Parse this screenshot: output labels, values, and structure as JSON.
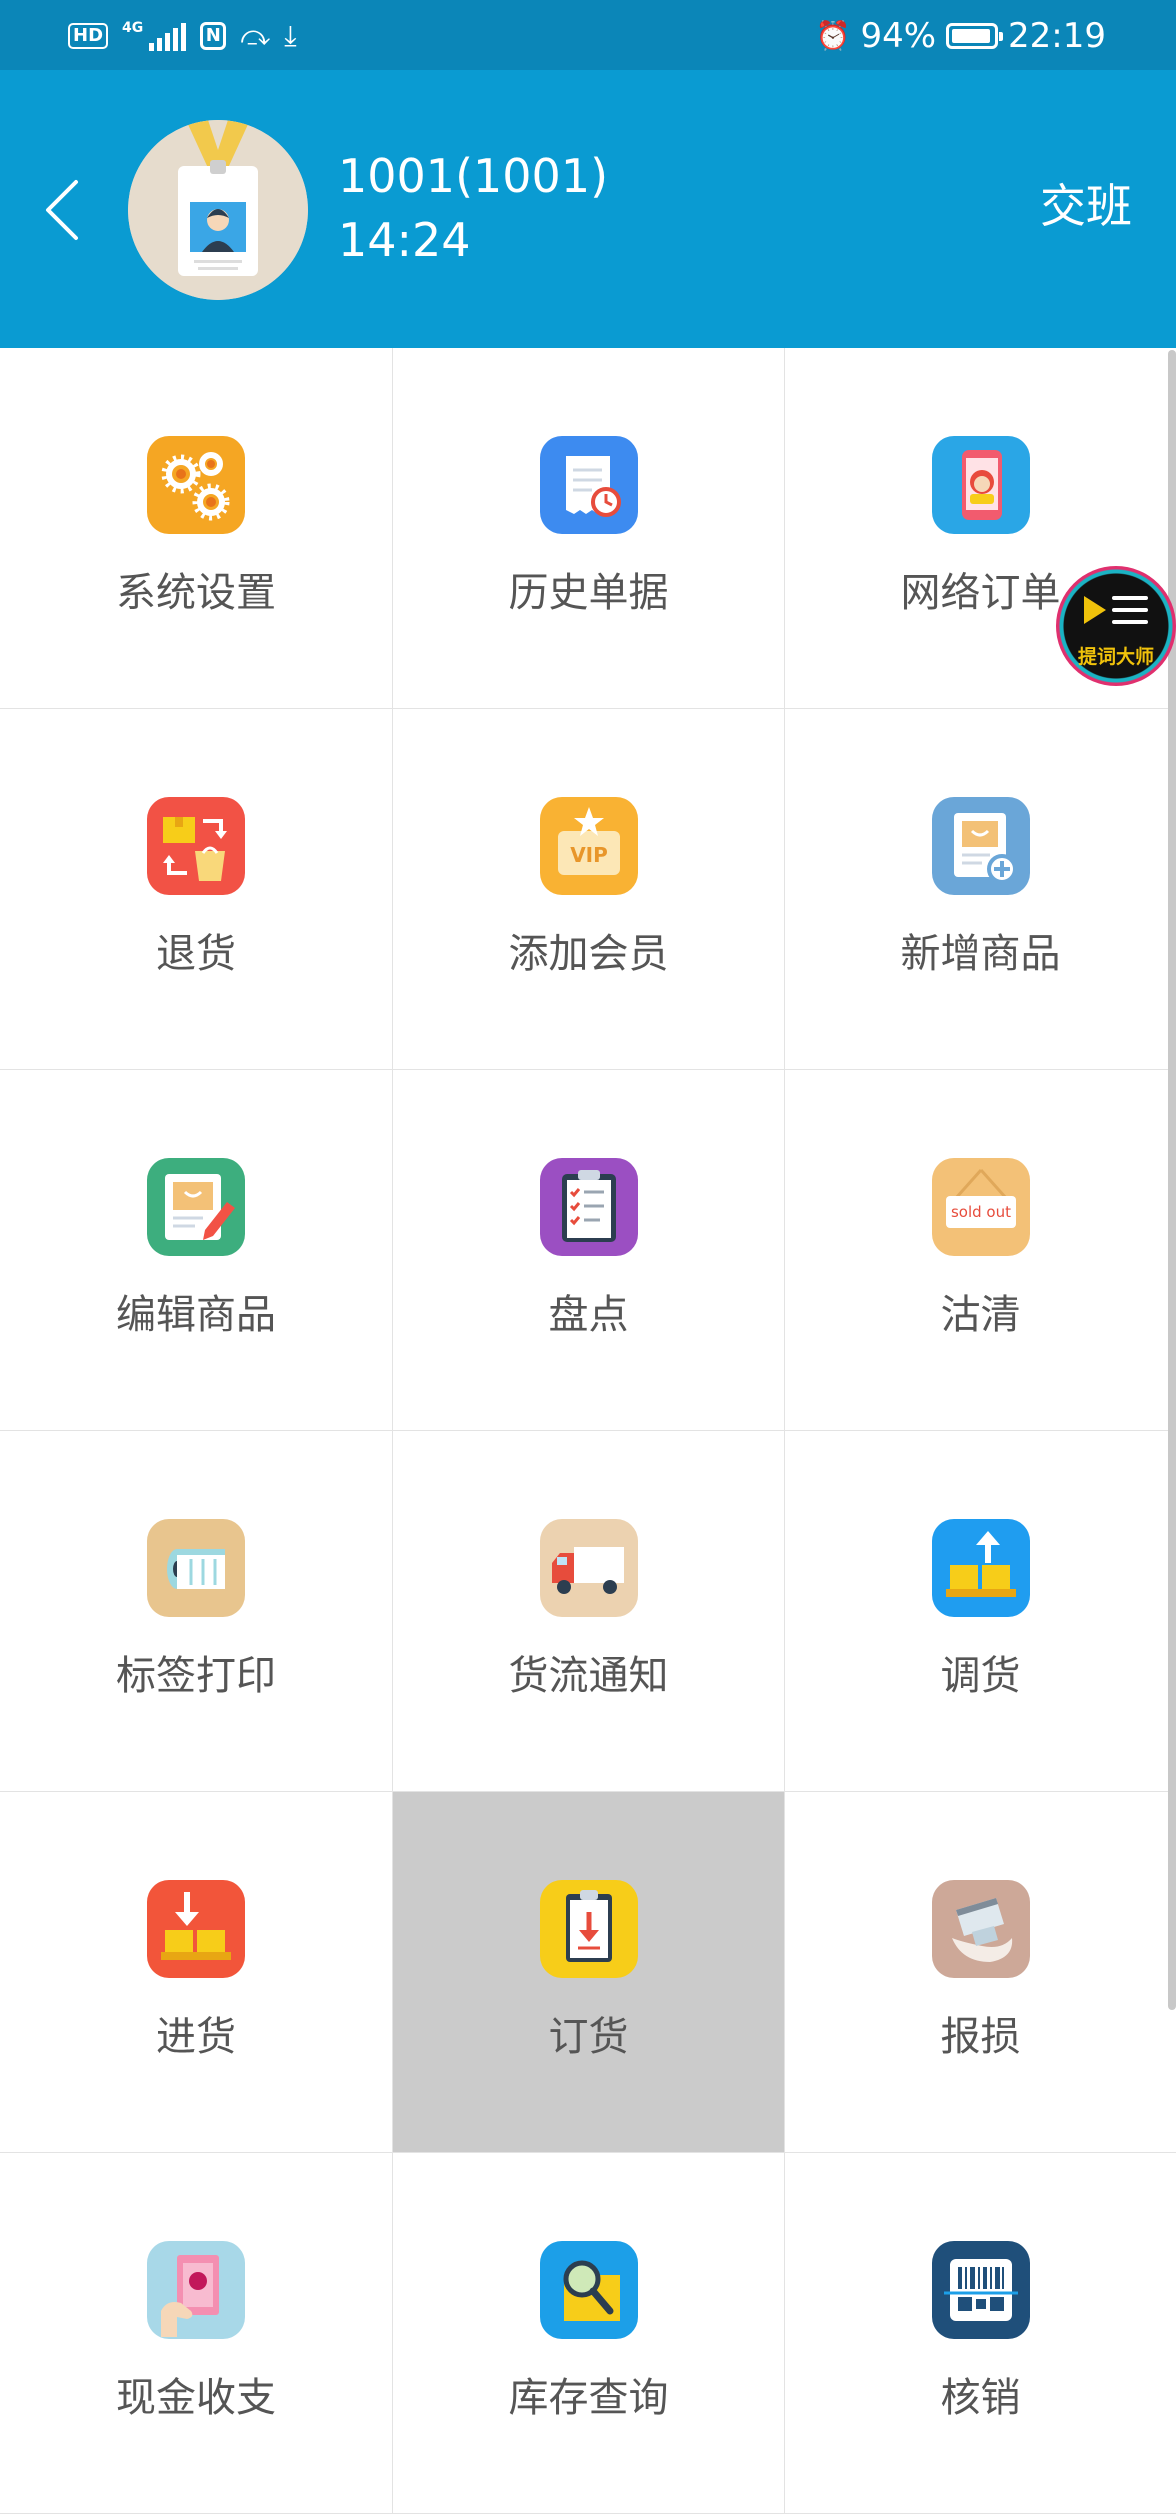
{
  "status_bar": {
    "hd": "HD",
    "network": "4G",
    "nfc": "N",
    "battery_percent": "94%",
    "battery_level": 0.94,
    "time": "22:19"
  },
  "header": {
    "user_name": "1001(1001)",
    "time": "14:24",
    "handover": "交班"
  },
  "menu": [
    {
      "label": "系统设置",
      "icon": "settings-gears-icon",
      "color": "#f5a623"
    },
    {
      "label": "历史单据",
      "icon": "history-receipt-icon",
      "color": "#3d8bf0"
    },
    {
      "label": "网络订单",
      "icon": "online-order-icon",
      "color": "#2aa6e6"
    },
    {
      "label": "退货",
      "icon": "return-goods-icon",
      "color": "#f25245"
    },
    {
      "label": "添加会员",
      "icon": "vip-card-icon",
      "color": "#f9b233"
    },
    {
      "label": "新增商品",
      "icon": "add-product-icon",
      "color": "#6aa6d8"
    },
    {
      "label": "编辑商品",
      "icon": "edit-product-icon",
      "color": "#3dae7e"
    },
    {
      "label": "盘点",
      "icon": "inventory-clipboard-icon",
      "color": "#9b4fc2"
    },
    {
      "label": "沽清",
      "icon": "sold-out-icon",
      "color": "#f3c177"
    },
    {
      "label": "标签打印",
      "icon": "label-roll-icon",
      "color": "#e8c58e"
    },
    {
      "label": "货流通知",
      "icon": "delivery-truck-icon",
      "color": "#ecd2b0"
    },
    {
      "label": "调货",
      "icon": "transfer-goods-icon",
      "color": "#1f9df0"
    },
    {
      "label": "进货",
      "icon": "purchase-in-icon",
      "color": "#f2553a"
    },
    {
      "label": "订货",
      "icon": "order-goods-icon",
      "color": "#f7cd19"
    },
    {
      "label": "报损",
      "icon": "damage-report-icon",
      "color": "#cda898"
    },
    {
      "label": "现金收支",
      "icon": "cash-icon",
      "color": "#a8d8e8"
    },
    {
      "label": "库存查询",
      "icon": "stock-search-icon",
      "color": "#1c9fe8"
    },
    {
      "label": "核销",
      "icon": "barcode-scan-icon",
      "color": "#1f4f7a"
    }
  ],
  "floating_bubble": {
    "text": "提词大师"
  }
}
